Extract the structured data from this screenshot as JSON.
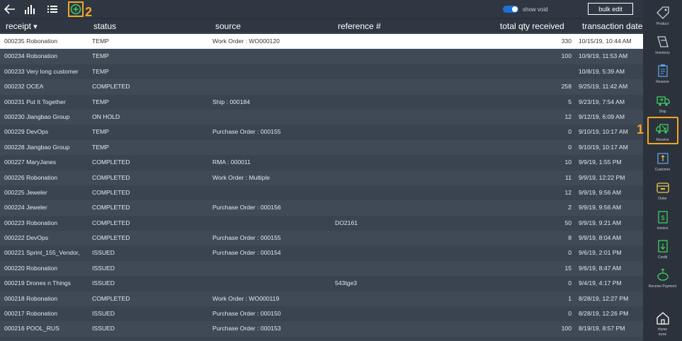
{
  "toolbar": {
    "icons": [
      "back-arrow-icon",
      "bar-chart-icon",
      "list-icon",
      "add-circle-icon"
    ],
    "toggle_label": "show void",
    "toggle_on": true,
    "bulk_edit_label": "bulk edit",
    "badge_2": "2"
  },
  "columns": {
    "receipt": "receipt",
    "status": "status",
    "source": "source",
    "reference": "reference #",
    "total_qty": "total qty received",
    "transaction_date": "transaction date"
  },
  "rows": [
    {
      "receipt": "000235 Robonation",
      "status": "TEMP",
      "source": "Work Order : WO000120",
      "reference": "",
      "qty": "330",
      "date": "10/15/19, 10:44 AM"
    },
    {
      "receipt": "000234 Robonation",
      "status": "TEMP",
      "source": "",
      "reference": "",
      "qty": "100",
      "date": "10/9/19, 11:53 AM"
    },
    {
      "receipt": "000233 Very long customer",
      "status": "TEMP",
      "source": "",
      "reference": "",
      "qty": "",
      "date": "10/8/19, 5:39 AM"
    },
    {
      "receipt": "000232 OCEA",
      "status": "COMPLETED",
      "source": "",
      "reference": "",
      "qty": "258",
      "date": "9/25/19, 11:42 AM"
    },
    {
      "receipt": "000231 Put It Together",
      "status": "TEMP",
      "source": "Ship : 000184",
      "reference": "",
      "qty": "5",
      "date": "9/23/19, 7:54 AM"
    },
    {
      "receipt": "000230 Jiangbao Group",
      "status": "ON HOLD",
      "source": "",
      "reference": "",
      "qty": "12",
      "date": "9/12/19, 6:09 AM"
    },
    {
      "receipt": "000229 DevOps",
      "status": "TEMP",
      "source": "Purchase Order : 000155",
      "reference": "",
      "qty": "0",
      "date": "9/10/19, 10:17 AM"
    },
    {
      "receipt": "000228 Jiangbao Group",
      "status": "TEMP",
      "source": "",
      "reference": "",
      "qty": "0",
      "date": "9/10/19, 10:17 AM"
    },
    {
      "receipt": "000227 MaryJanes",
      "status": "COMPLETED",
      "source": "RMA : 000011",
      "reference": "",
      "qty": "10",
      "date": "9/9/19, 1:55 PM"
    },
    {
      "receipt": "000226 Robonation",
      "status": "COMPLETED",
      "source": "Work Order : Multiple",
      "reference": "",
      "qty": "11",
      "date": "9/9/19, 12:22 PM"
    },
    {
      "receipt": "000225 Jeweler",
      "status": "COMPLETED",
      "source": "",
      "reference": "",
      "qty": "12",
      "date": "9/9/19, 9:56 AM"
    },
    {
      "receipt": "000224 Jeweler",
      "status": "COMPLETED",
      "source": "Purchase Order : 000156",
      "reference": "",
      "qty": "2",
      "date": "9/9/19, 9:56 AM"
    },
    {
      "receipt": "000223 Robonation",
      "status": "COMPLETED",
      "source": "",
      "reference": "DO2161",
      "qty": "50",
      "date": "9/9/19, 9:21 AM"
    },
    {
      "receipt": "000222 DevOps",
      "status": "COMPLETED",
      "source": "Purchase Order : 000155",
      "reference": "",
      "qty": "8",
      "date": "9/9/19, 8:04 AM"
    },
    {
      "receipt": "000221 Sprint_155_Vendor,",
      "status": "ISSUED",
      "source": "Purchase Order : 000154",
      "reference": "",
      "qty": "0",
      "date": "9/6/19, 2:01 PM"
    },
    {
      "receipt": "000220 Robonation",
      "status": "ISSUED",
      "source": "",
      "reference": "",
      "qty": "15",
      "date": "9/6/19, 8:47 AM"
    },
    {
      "receipt": "000219 Drones n Things",
      "status": "ISSUED",
      "source": "",
      "reference": "543tge3",
      "qty": "0",
      "date": "9/4/19, 4:17 PM"
    },
    {
      "receipt": "000218 Robonation",
      "status": "COMPLETED",
      "source": "Work Order : WO000119",
      "reference": "",
      "qty": "1",
      "date": "8/28/19, 12:27 PM"
    },
    {
      "receipt": "000217 Robonation",
      "status": "ISSUED",
      "source": "Purchase Order : 000150",
      "reference": "",
      "qty": "0",
      "date": "8/28/19, 12:26 PM"
    },
    {
      "receipt": "000216 POOL_RUS",
      "status": "ISSUED",
      "source": "Purchase Order : 000153",
      "reference": "",
      "qty": "100",
      "date": "8/19/19, 8:57 PM"
    }
  ],
  "sidebar": {
    "items": [
      {
        "label": "Product",
        "icon": "product-tag-icon"
      },
      {
        "label": "Inventory",
        "icon": "inventory-icon"
      },
      {
        "label": "Reserve",
        "icon": "reserve-clipboard-icon"
      },
      {
        "label": "Ship",
        "icon": "ship-truck-icon"
      },
      {
        "label": "Receive",
        "icon": "receive-truck-icon"
      },
      {
        "label": "Customer",
        "icon": "customer-icon"
      },
      {
        "label": "Order",
        "icon": "order-box-icon"
      },
      {
        "label": "Invoice",
        "icon": "invoice-dollar-icon"
      },
      {
        "label": "Credit",
        "icon": "credit-icon"
      },
      {
        "label": "Receive Payment",
        "icon": "receive-payment-icon"
      },
      {
        "label": "Home",
        "icon": "home-icon"
      }
    ],
    "more_label": "more",
    "badge_1": "1"
  },
  "colors": {
    "background": "#3a4350",
    "row_alt": "#404a57",
    "toolbar": "#2f3742",
    "sidebar": "#2c323c",
    "accent_green": "#3ecf5f",
    "highlight_orange": "#f5a623",
    "toggle_blue": "#1e6fd9",
    "icon_yellow": "#e8c94a"
  }
}
